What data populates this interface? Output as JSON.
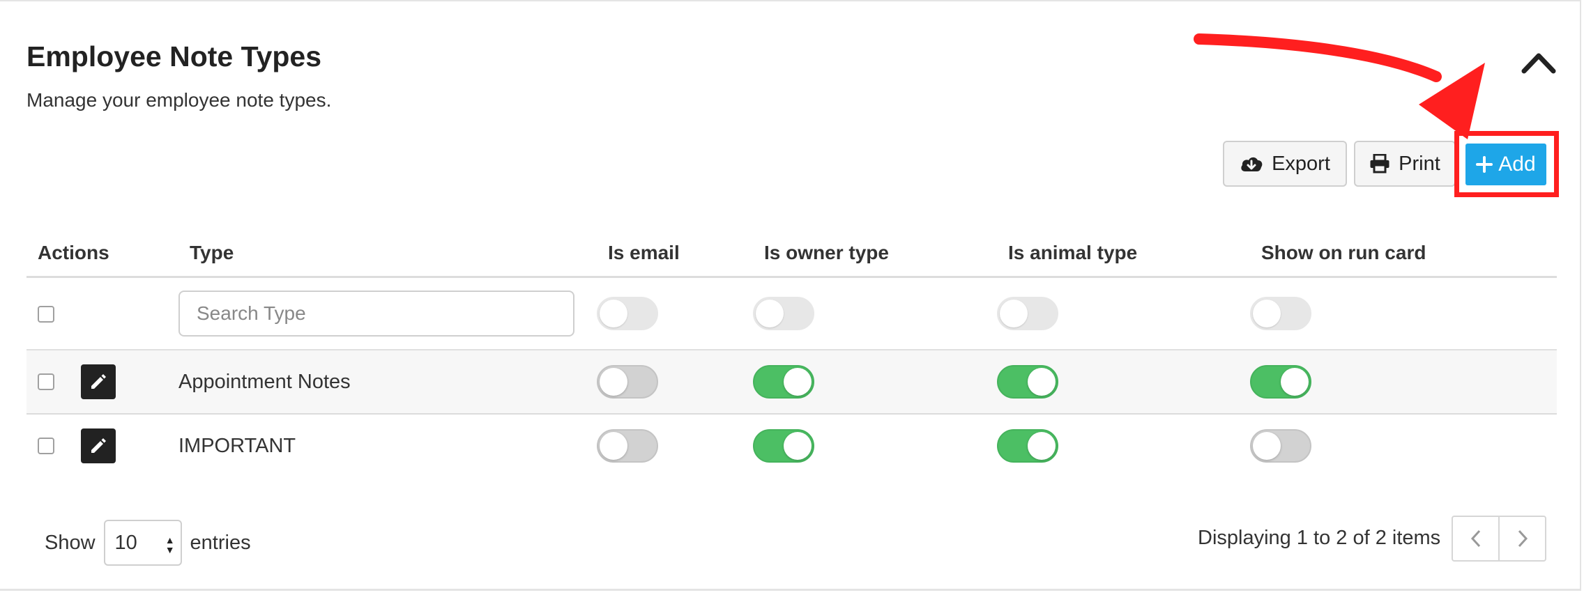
{
  "header": {
    "title": "Employee Note Types",
    "subtitle": "Manage your employee note types."
  },
  "toolbar": {
    "export_label": "Export",
    "print_label": "Print",
    "add_label": "Add"
  },
  "table": {
    "columns": [
      "Actions",
      "Type",
      "Is email",
      "Is owner type",
      "Is animal type",
      "Show on run card"
    ],
    "search_placeholder": "Search Type",
    "rows": [
      {
        "type": "Appointment Notes",
        "is_email": false,
        "is_owner_type": true,
        "is_animal_type": true,
        "show_on_run_card": true
      },
      {
        "type": "IMPORTANT",
        "is_email": false,
        "is_owner_type": true,
        "is_animal_type": true,
        "show_on_run_card": false
      }
    ]
  },
  "footer": {
    "show_label": "Show",
    "page_size": "10",
    "entries_label": "entries",
    "info": "Displaying 1 to 2 of 2 items"
  },
  "colors": {
    "accent": "#1ea6e8",
    "toggle_on": "#4cbf64",
    "annotation": "#ff1f1f"
  },
  "icons": {
    "collapse": "chevron-up-icon",
    "export": "cloud-download-icon",
    "print": "printer-icon",
    "add": "plus-icon",
    "edit": "pencil-icon",
    "prev": "chevron-left-icon",
    "next": "chevron-right-icon"
  }
}
